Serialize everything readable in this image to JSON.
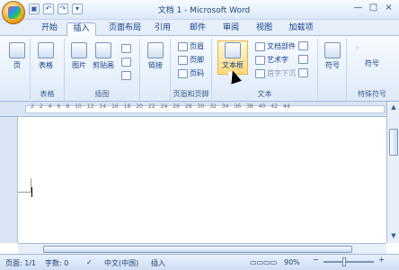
{
  "window": {
    "title": "文档 1 - Microsoft Word"
  },
  "tabs": [
    {
      "label": "开始"
    },
    {
      "label": "插入"
    },
    {
      "label": "页面布局"
    },
    {
      "label": "引用"
    },
    {
      "label": "邮件"
    },
    {
      "label": "审阅"
    },
    {
      "label": "视图"
    },
    {
      "label": "加载项"
    }
  ],
  "ribbon": {
    "groups": [
      {
        "label": "表格"
      },
      {
        "label": "插图"
      },
      {
        "label": "页眉和页脚"
      },
      {
        "label": "文本"
      },
      {
        "label": "特殊符号"
      }
    ],
    "buttons": {
      "page": "页",
      "table": "表格",
      "picture": "图片",
      "clipart": "剪贴画",
      "link": "链接",
      "header": "页眉",
      "footer": "页脚",
      "pagenum": "页码",
      "textbox": "文本框",
      "docparts": "文档部件",
      "wordart": "艺术字",
      "dropcap": "首字下沉",
      "symbol": "符号",
      "symbol2": "符号",
      "blank": "·"
    }
  },
  "ruler": {
    "ticks": [
      "2",
      "2",
      "4",
      "6",
      "8",
      "10",
      "12",
      "14",
      "16",
      "18",
      "20",
      "22",
      "24",
      "26",
      "28",
      "30",
      "32",
      "34",
      "36",
      "38",
      "40",
      "42",
      "44"
    ]
  },
  "status": {
    "page": "页面: 1/1",
    "words": "字数: 0",
    "lang": "中文(中国)",
    "mode": "插入",
    "zoom": "90%"
  }
}
